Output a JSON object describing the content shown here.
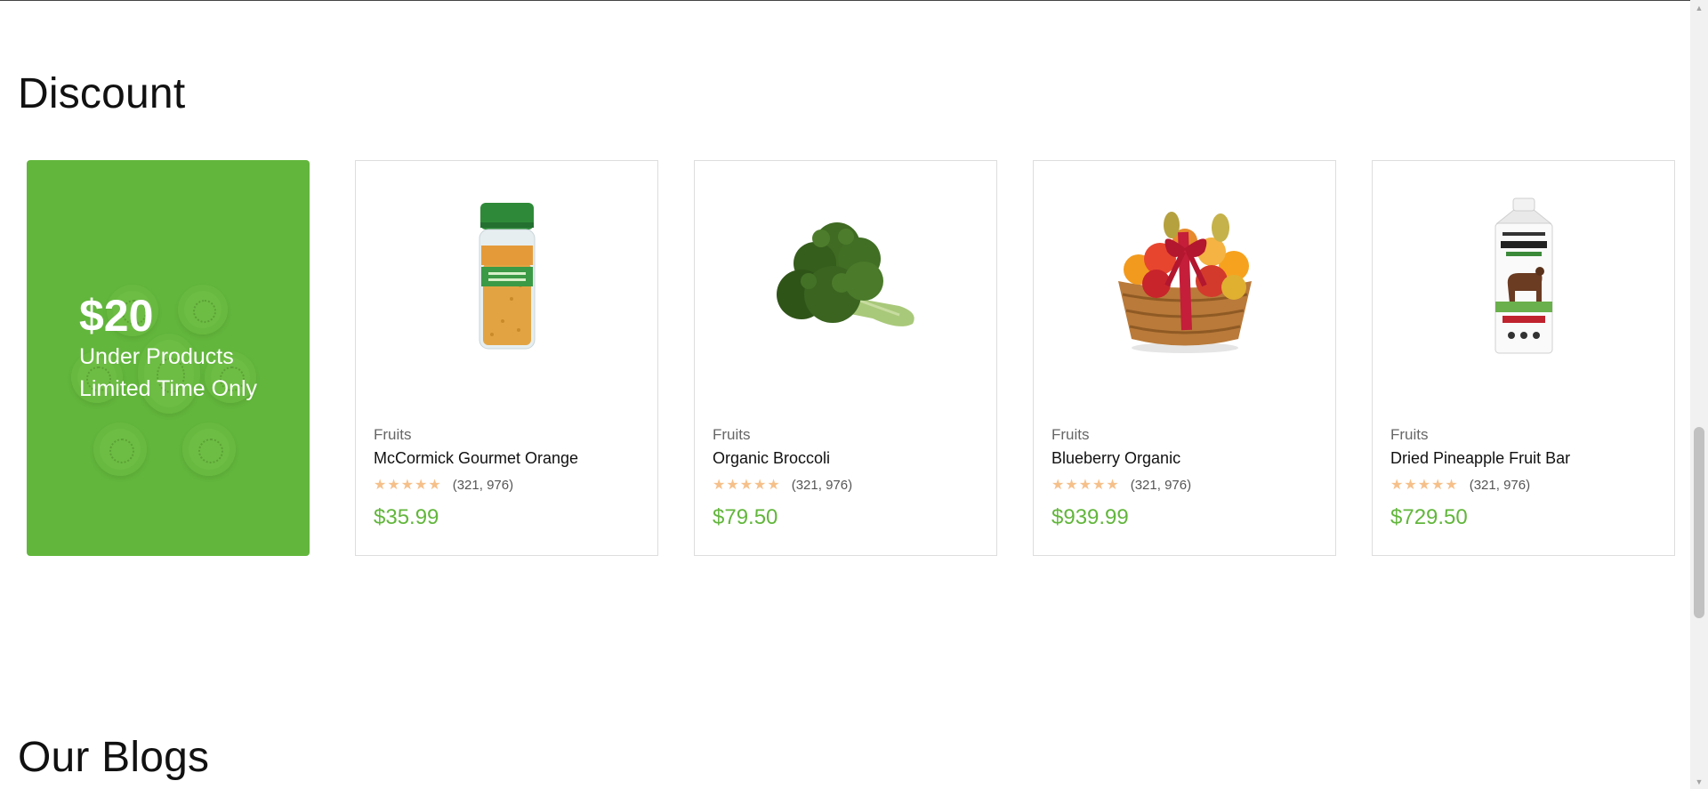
{
  "sections": {
    "discount_title": "Discount",
    "blogs_title": "Our Blogs"
  },
  "promo": {
    "price": "$20",
    "line1": "Under Products",
    "line2": "Limited Time Only",
    "background_color": "#62b63c"
  },
  "products": [
    {
      "category": "Fruits",
      "name": "McCormick Gourmet Orange",
      "stars": "★★★★★",
      "reviews": "(321, 976)",
      "price": "$35.99",
      "image_icon": "spice-jar-icon"
    },
    {
      "category": "Fruits",
      "name": "Organic Broccoli",
      "stars": "★★★★★",
      "reviews": "(321, 976)",
      "price": "$79.50",
      "image_icon": "broccoli-icon"
    },
    {
      "category": "Fruits",
      "name": "Blueberry Organic",
      "stars": "★★★★★",
      "reviews": "(321, 976)",
      "price": "$939.99",
      "image_icon": "fruit-basket-icon"
    },
    {
      "category": "Fruits",
      "name": "Dried Pineapple Fruit Bar",
      "stars": "★★★★★",
      "reviews": "(321, 976)",
      "price": "$729.50",
      "image_icon": "milk-carton-icon"
    }
  ],
  "colors": {
    "accent": "#62b63c",
    "star": "#f6c08a"
  }
}
